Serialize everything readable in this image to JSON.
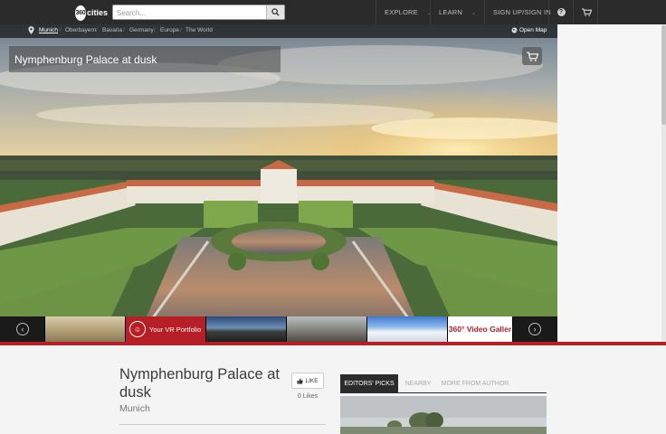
{
  "header": {
    "logo_circle_text": "360",
    "logo_word": "cities",
    "search_placeholder": "Search...",
    "nav": {
      "explore": "EXPLORE",
      "learn": "LEARN",
      "signup": "SIGN UP/SIGN IN"
    },
    "help_symbol": "?"
  },
  "breadcrumb": [
    "Munich",
    "Oberbayern",
    "Bavaria",
    "Germany",
    "Europe",
    "The World"
  ],
  "breadcrumb_separator": "/",
  "open_map_label": "Open Map",
  "panorama": {
    "title": "Nymphenburg Palace at dusk"
  },
  "thumb_strip": {
    "vr_portfolio_label": "Your VR Portfolio",
    "video_gallery_label": "360° Video Galler",
    "prev_symbol": "‹",
    "next_symbol": "›"
  },
  "detail": {
    "title": "Nymphenburg Palace at dusk",
    "location": "Munich",
    "like_label": "LIKE",
    "likes_count": "0 Likes"
  },
  "tabs": [
    "EDITORS' PICKS",
    "NEARBY",
    "MORE FROM AUTHOR"
  ],
  "icons": [
    "search-icon",
    "chevron-down-icon",
    "help-icon",
    "cart-icon",
    "map-pin-icon",
    "globe-icon",
    "thumbs-up-icon",
    "chevron-left-icon",
    "chevron-right-icon"
  ],
  "colors": {
    "topbar": "#2b2b2b",
    "accent_red": "#b81e25",
    "background": "#f4f4f4"
  }
}
